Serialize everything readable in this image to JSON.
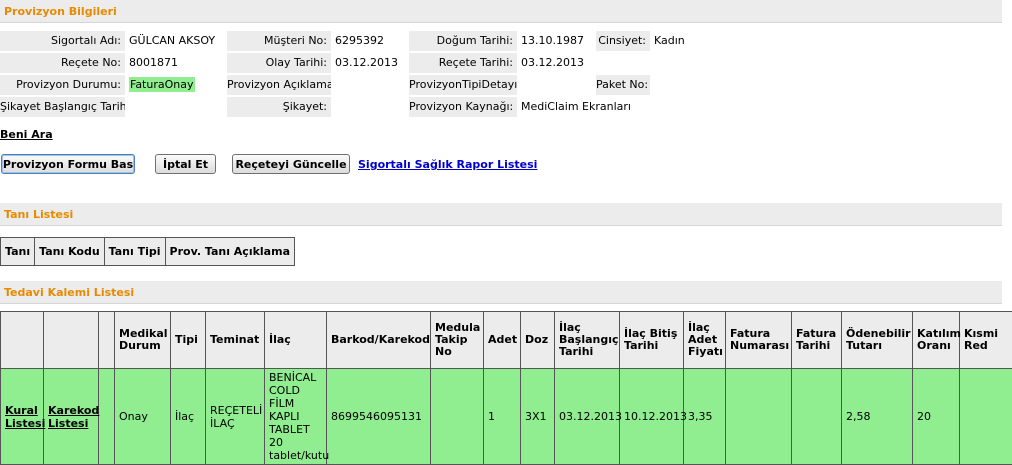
{
  "provizyon": {
    "header": "Provizyon Bilgileri",
    "rows": [
      [
        {
          "label": "Sigortalı Adı:",
          "value": "GÜLCAN AKSOY"
        },
        {
          "label": "Müşteri No:",
          "value": "6295392"
        },
        {
          "label": "Doğum Tarihi:",
          "value": "13.10.1987"
        },
        {
          "label": "Cinsiyet:",
          "value": "Kadın"
        }
      ],
      [
        {
          "label": "Reçete No:",
          "value": "8001871"
        },
        {
          "label": "Olay Tarihi:",
          "value": "03.12.2013"
        },
        {
          "label": "Reçete Tarihi:",
          "value": "03.12.2013"
        }
      ],
      [
        {
          "label": "Provizyon Durumu:",
          "value": "FaturaOnay"
        },
        {
          "label": "Provizyon Açıklama:",
          "value": ""
        },
        {
          "label": "ProvizyonTipiDetayı:",
          "value": ""
        },
        {
          "label": "Paket No:",
          "value": ""
        }
      ],
      [
        {
          "label": "Şikayet Başlangıç Tarihi:",
          "value": ""
        },
        {
          "label": "Şikayet:",
          "value": ""
        },
        {
          "label": "Provizyon Kaynağı:",
          "value": "MediClaim Ekranları"
        }
      ]
    ]
  },
  "beni_ara": "Beni Ara",
  "buttons": {
    "form_bas": "Provizyon Formu Bas",
    "iptal": "İptal Et",
    "guncelle": "Reçeteyi Güncelle",
    "rapor_link": "Sigortalı Sağlık Rapor Listesi"
  },
  "tani": {
    "header": "Tanı Listesi",
    "columns": [
      "Tanı",
      "Tanı Kodu",
      "Tanı Tipi",
      "Prov. Tanı Açıklama"
    ]
  },
  "tedavi": {
    "header": "Tedavi Kalemi Listesi",
    "columns": [
      "",
      "",
      "",
      "Medikal Durum",
      "Tipi",
      "Teminat",
      "İlaç",
      "Barkod/Karekod",
      "Medula Takip No",
      "Adet",
      "Doz",
      "İlaç Başlangıç Tarihi",
      "İlaç Bitiş Tarihi",
      "İlaç Adet Fiyatı",
      "Fatura Numarası",
      "Fatura Tarihi",
      "Ödenebilir Tutarı",
      "Katılım Oranı",
      "Kısmi Red"
    ],
    "row": {
      "kural": "Kural Listesi",
      "karekod": "Karekod Listesi",
      "blank": "",
      "medikal_durum": "Onay",
      "tipi": "İlaç",
      "teminat": "REÇETELİ İLAÇ",
      "ilac": "BENİCAL COLD FİLM KAPLI TABLET 20 tablet/kutu",
      "barkod": "8699546095131",
      "medula": "",
      "adet": "1",
      "doz": "3X1",
      "baslangic": "03.12.2013",
      "bitis": "10.12.2013",
      "fiyat": "3,35",
      "fatura_no": "",
      "fatura_tarihi": "",
      "odenebilir": "2,58",
      "katilim": "20",
      "kismi_red": ""
    }
  }
}
